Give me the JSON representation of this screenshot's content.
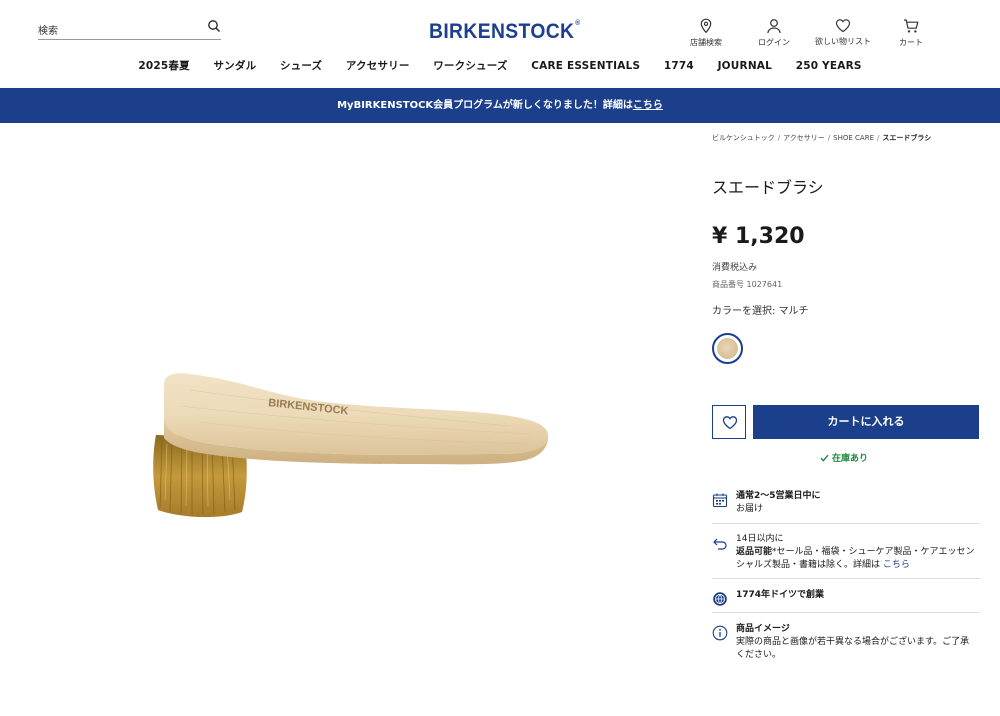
{
  "search": {
    "placeholder": "検索"
  },
  "brand": {
    "logo": "BIRKENSTOCK",
    "color": "#1c3f8c"
  },
  "utility": {
    "store": "店舗検索",
    "login": "ログイン",
    "wishlist": "欲しい物リスト",
    "cart": "カート"
  },
  "nav": [
    "2025春夏",
    "サンダル",
    "シューズ",
    "アクセサリー",
    "ワークシューズ",
    "CARE ESSENTIALS",
    "1774",
    "JOURNAL",
    "250 YEARS"
  ],
  "banner": {
    "text": "MyBIRKENSTOCK会員プログラムが新しくなりました！詳細は",
    "link": "こちら"
  },
  "breadcrumb": [
    "ビルケンシュトック",
    "アクセサリー",
    "SHOE CARE",
    "スエードブラシ"
  ],
  "product": {
    "title": "スエードブラシ",
    "price": "¥ 1,320",
    "tax_note": "消費税込み",
    "sku": "商品番号 1027641",
    "color_label": "カラーを選択: マルチ",
    "image_brand_text": "BIRKENSTOCK"
  },
  "actions": {
    "add_to_cart": "カートに入れる",
    "stock_status": "在庫あり"
  },
  "info": {
    "delivery_title": "通常2～5営業日中に",
    "delivery_sub": "お届け",
    "return_line1": "14日以内に",
    "return_bold": "返品可能",
    "return_rest": "*セール品・福袋・シューケア製品・ケアエッセンシャルズ製品・書籍は除く。詳細は",
    "return_link": "こちら",
    "heritage": "1774年ドイツで創業",
    "image_title": "商品イメージ",
    "image_text": "実際の商品と画像が若干異なる場合がございます。ご了承ください。"
  }
}
